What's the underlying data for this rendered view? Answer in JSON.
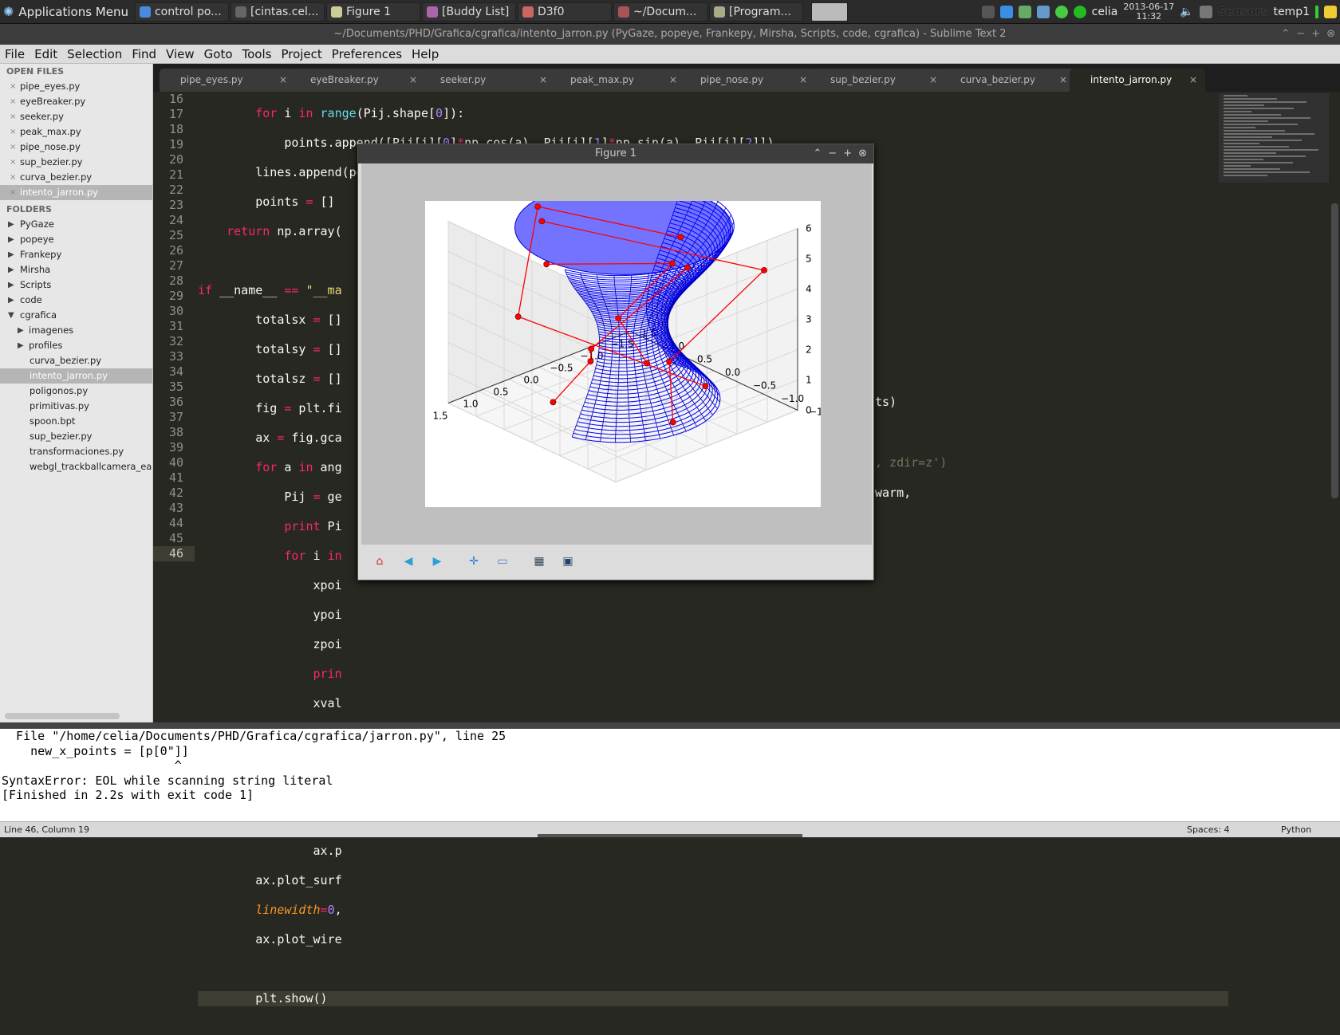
{
  "taskbar": {
    "app_menu_label": "Applications Menu",
    "tasks": [
      {
        "label": "control po...",
        "icon": "chrome-icon"
      },
      {
        "label": "[cintas.cel...",
        "icon": "terminal-icon"
      },
      {
        "label": "Figure 1",
        "icon": "figure-icon"
      },
      {
        "label": "[Buddy List]",
        "icon": "pidgin-icon"
      },
      {
        "label": "D3f0",
        "icon": "chat-icon"
      },
      {
        "label": "~/Docum...",
        "icon": "editor-icon"
      },
      {
        "label": "[Program...",
        "icon": "folder-icon"
      }
    ],
    "user": "celia",
    "date": "2013-06-17",
    "time": "11:32",
    "sensors_label": "Sensors",
    "temp_label": "temp1"
  },
  "window": {
    "title": "~/Documents/PHD/Grafica/cgrafica/intento_jarron.py (PyGaze, popeye, Frankepy, Mirsha, Scripts, code, cgrafica) - Sublime Text 2"
  },
  "menu": [
    "File",
    "Edit",
    "Selection",
    "Find",
    "View",
    "Goto",
    "Tools",
    "Project",
    "Preferences",
    "Help"
  ],
  "sidebar": {
    "open_files_header": "OPEN FILES",
    "open_files": [
      "pipe_eyes.py",
      "eyeBreaker.py",
      "seeker.py",
      "peak_max.py",
      "pipe_nose.py",
      "sup_bezier.py",
      "curva_bezier.py",
      "intento_jarron.py"
    ],
    "folders_header": "FOLDERS",
    "folders": [
      "PyGaze",
      "popeye",
      "Frankepy",
      "Mirsha",
      "Scripts",
      "code",
      "cgrafica"
    ],
    "cgrafica_subfolders": [
      "imagenes",
      "profiles"
    ],
    "cgrafica_files": [
      "curva_bezier.py",
      "intento_jarron.py",
      "poligonos.py",
      "primitivas.py",
      "spoon.bpt",
      "sup_bezier.py",
      "transformaciones.py",
      "webgl_trackballcamera_ear"
    ]
  },
  "tabs": [
    "pipe_eyes.py",
    "eyeBreaker.py",
    "seeker.py",
    "peak_max.py",
    "pipe_nose.py",
    "sup_bezier.py",
    "curva_bezier.py",
    "intento_jarron.py"
  ],
  "editor": {
    "line_numbers": [
      "16",
      "17",
      "18",
      "19",
      "20",
      "21",
      "22",
      "23",
      "24",
      "25",
      "26",
      "27",
      "28",
      "29",
      "30",
      "31",
      "32",
      "33",
      "34",
      "35",
      "36",
      "37",
      "38",
      "39",
      "40",
      "41",
      "42",
      "43",
      "44",
      "45",
      "46"
    ],
    "right_fragments": {
      "l36": "ts)",
      "l40": ", zdir=z')",
      "l42": "warm,"
    }
  },
  "figure": {
    "title": "Figure 1",
    "toolbar": [
      "home-icon",
      "back-icon",
      "forward-icon",
      "pan-icon",
      "zoom-icon",
      "subplots-icon",
      "save-icon"
    ]
  },
  "chart_data": {
    "type": "surface-3d",
    "title": "",
    "z_ticks": [
      "0",
      "1",
      "2",
      "3",
      "4",
      "5",
      "6"
    ],
    "x_ticks": [
      "1.5",
      "1.0",
      "0.5",
      "0.0",
      "−0.5",
      "−1.0",
      "−1.5"
    ],
    "y_ticks": [
      "−1.5",
      "−1.0",
      "−0.5",
      "0.0",
      "0.5",
      "1.0",
      "1.5"
    ],
    "zlim": [
      0,
      6
    ],
    "xlim": [
      -1.5,
      1.5
    ],
    "ylim": [
      -1.5,
      1.5
    ],
    "surface_color": "#0000ff",
    "control_polygon_color": "#ff0000",
    "grid": true
  },
  "console": [
    "  File \"/home/celia/Documents/PHD/Grafica/cgrafica/jarron.py\", line 25",
    "    new_x_points = [p[0\"]]",
    "                        ^",
    "SyntaxError: EOL while scanning string literal",
    "[Finished in 2.2s with exit code 1]"
  ],
  "status": {
    "position": "Line 46, Column 19",
    "spaces": "Spaces: 4",
    "syntax": "Python"
  }
}
